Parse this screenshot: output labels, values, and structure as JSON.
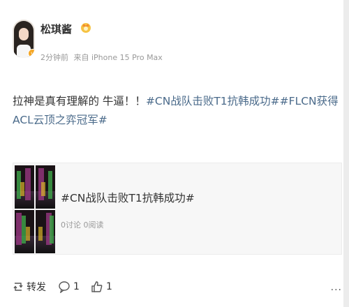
{
  "user": {
    "name": "松琪酱",
    "badge_icon": "crown-icon",
    "verified_icon": "v-badge-icon"
  },
  "meta": {
    "time": "2分钟前",
    "source": "来自 iPhone 15 Pro Max"
  },
  "post": {
    "text": "拉神是真有理解的 牛逼！！",
    "topic_1": "#CN战队击败T1抗韩成功#",
    "topic_2": "#FLCN获得ACL云顶之弈冠军#"
  },
  "card": {
    "title": "#CN战队击败T1抗韩成功#",
    "discussions": "0讨论",
    "reads": "0阅读"
  },
  "actions": {
    "repost_label": "转发",
    "comment_count": "1",
    "like_count": "1"
  },
  "colors": {
    "topic": "#4a6a8a",
    "text": "#333333",
    "meta": "#999999"
  }
}
